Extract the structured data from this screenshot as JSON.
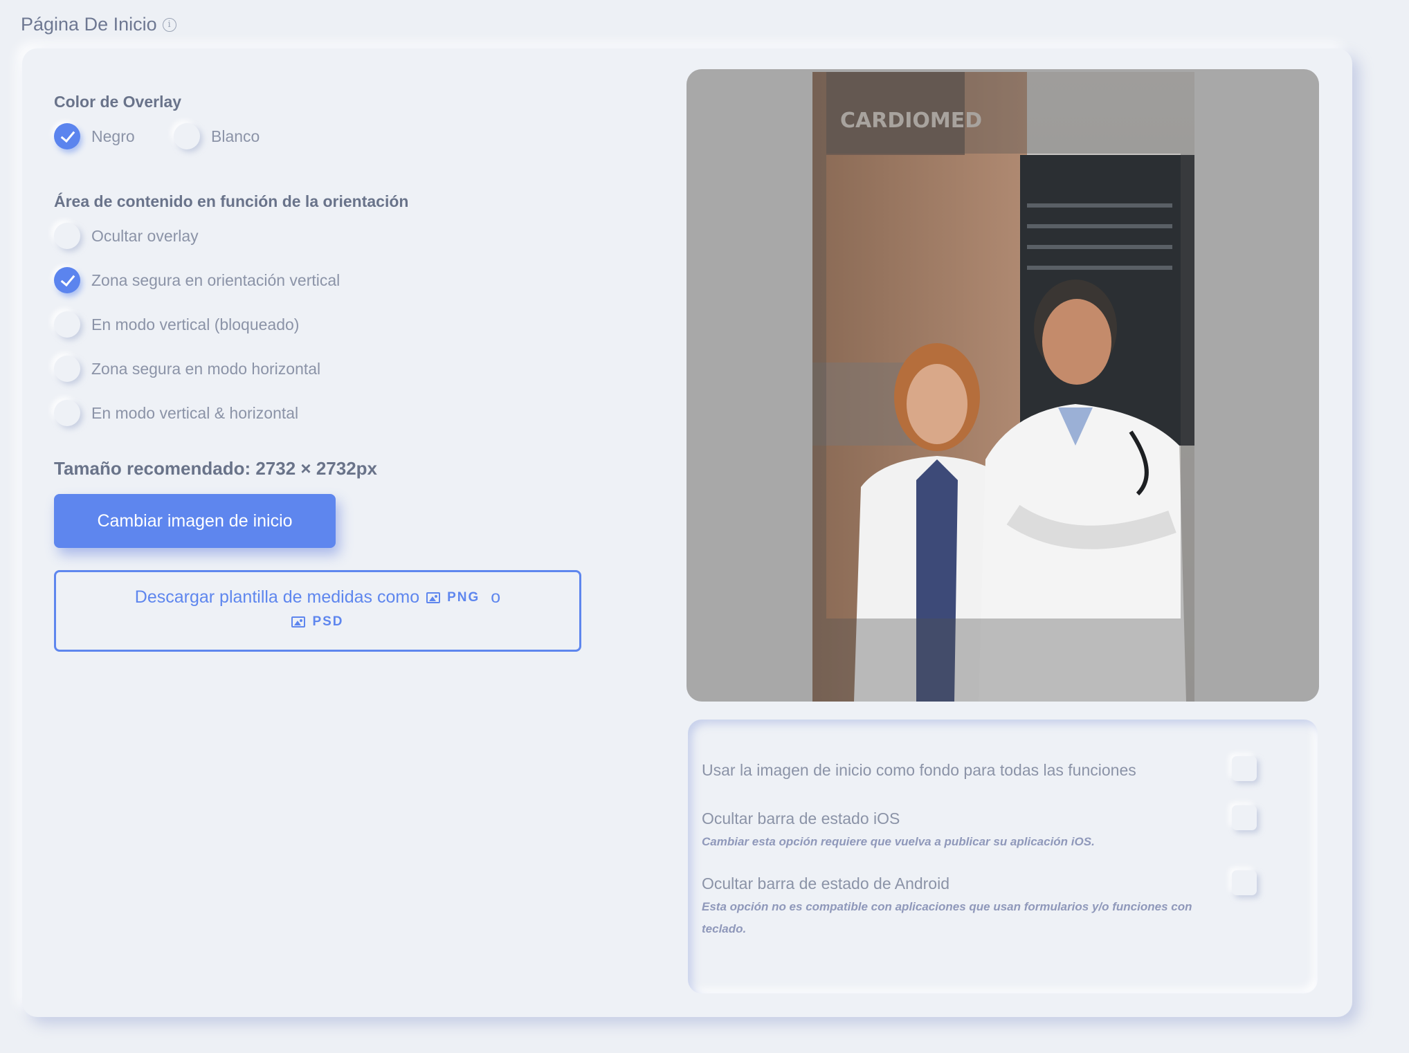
{
  "page": {
    "title": "Página De Inicio"
  },
  "overlay": {
    "label": "Color de Overlay",
    "options": [
      {
        "label": "Negro",
        "checked": true
      },
      {
        "label": "Blanco",
        "checked": false
      }
    ]
  },
  "orientation": {
    "label": "Área de contenido en función de la orientación",
    "options": [
      {
        "label": "Ocultar overlay",
        "checked": false
      },
      {
        "label": "Zona segura en orientación vertical",
        "checked": true
      },
      {
        "label": "En modo vertical (bloqueado)",
        "checked": false
      },
      {
        "label": "Zona segura en modo horizontal",
        "checked": false
      },
      {
        "label": "En modo vertical & horizontal",
        "checked": false
      }
    ]
  },
  "size": {
    "label": "Tamaño recomendado: 2732 × 2732px"
  },
  "buttons": {
    "change_image": "Cambiar imagen de inicio"
  },
  "download": {
    "text": "Descargar plantilla de medidas como",
    "png": "PNG",
    "or": "o",
    "psd": "PSD"
  },
  "preview": {
    "sign_text": "CARDIOMED"
  },
  "settings": [
    {
      "label": "Usar la imagen de inicio como fondo para todas las funciones",
      "note": "",
      "checked": false
    },
    {
      "label": "Ocultar barra de estado iOS",
      "note": "Cambiar esta opción requiere que vuelva a publicar su aplicación iOS.",
      "checked": false
    },
    {
      "label": "Ocultar barra de estado de Android",
      "note": "Esta opción no es compatible con aplicaciones que usan formularios y/o funciones con teclado.",
      "checked": false
    }
  ],
  "colors": {
    "accent": "#5e86ee",
    "background": "#edf0f5",
    "preview_bg": "#a8a8a8"
  }
}
